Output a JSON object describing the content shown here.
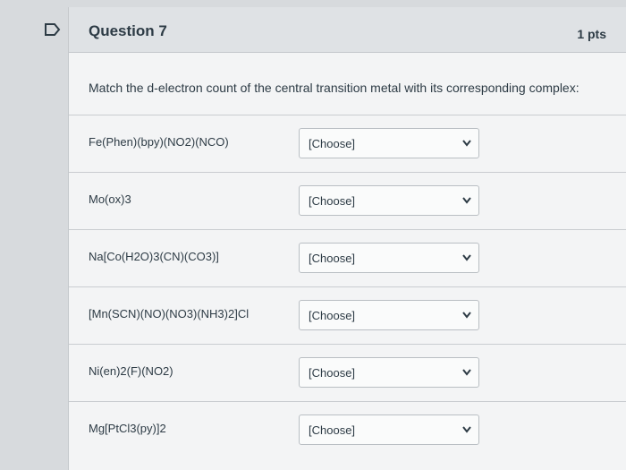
{
  "question": {
    "title": "Question 7",
    "points": "1 pts",
    "prompt": "Match the d-electron count of the central transition metal with its corresponding complex:"
  },
  "rows": [
    {
      "complex": "Fe(Phen)(bpy)(NO2)(NCO)",
      "selected": "[Choose]"
    },
    {
      "complex": "Mo(ox)3",
      "selected": "[Choose]"
    },
    {
      "complex": "Na[Co(H2O)3(CN)(CO3)]",
      "selected": "[Choose]"
    },
    {
      "complex": "[Mn(SCN)(NO)(NO3)(NH3)2]Cl",
      "selected": "[Choose]"
    },
    {
      "complex": "Ni(en)2(F)(NO2)",
      "selected": "[Choose]"
    },
    {
      "complex": "Mg[PtCl3(py)]2",
      "selected": "[Choose]"
    }
  ],
  "icons": {
    "flag": "flag-outline-icon",
    "dropdown": "chevron-down-icon"
  },
  "colors": {
    "text": "#2d3b45",
    "header_bg": "#dfe2e5",
    "card_bg": "#f3f4f5",
    "flag": "#2d3b45"
  }
}
